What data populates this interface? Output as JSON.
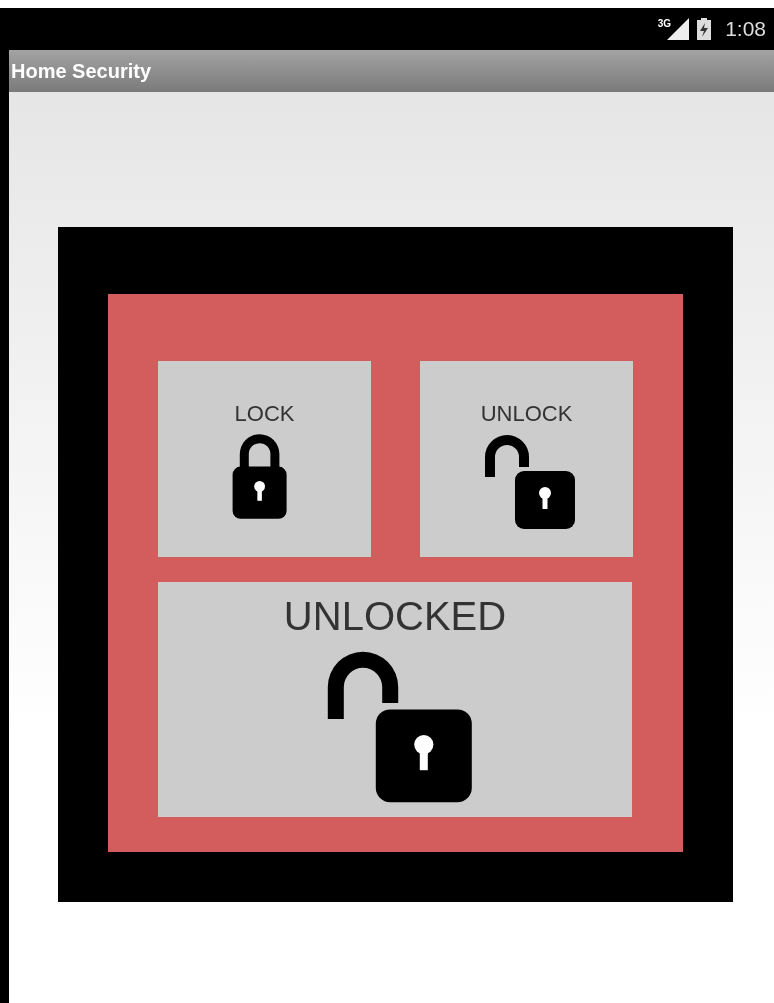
{
  "status_bar": {
    "network": "3G",
    "time": "1:08"
  },
  "action_bar": {
    "title": "Home Security"
  },
  "controls": [
    {
      "kind": "lock",
      "label": "LOCK"
    },
    {
      "kind": "unlock",
      "label": "UNLOCK"
    }
  ],
  "status": {
    "label": "UNLOCKED",
    "locked": false
  }
}
